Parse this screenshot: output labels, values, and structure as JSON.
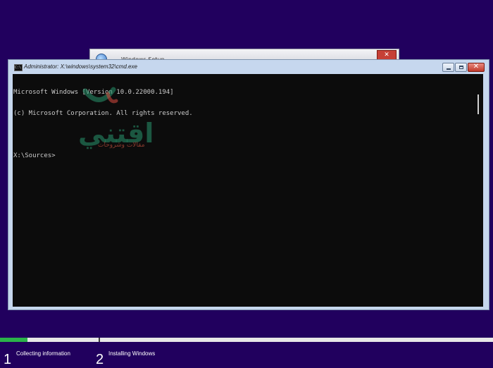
{
  "background_color": "#21005e",
  "setup_window": {
    "title": "Windows Setup",
    "close_label": "✕",
    "icon": "windows-setup-icon"
  },
  "cmd_window": {
    "title": "Administrator: X:\\windows\\system32\\cmd.exe",
    "icon_label": "C:\\",
    "console_lines": [
      "Microsoft Windows [Version 10.0.22000.194]",
      "(c) Microsoft Corporation. All rights reserved.",
      "",
      "X:\\Sources>"
    ],
    "close_label": "✕"
  },
  "watermark": {
    "text": "اقتني",
    "subtext": "مقالات وشروحات"
  },
  "progress": {
    "fraction_complete": 0.055,
    "fill_color": "#2bb24a",
    "steps": [
      {
        "number": "1",
        "label": "Collecting information"
      },
      {
        "number": "2",
        "label": "Installing Windows"
      }
    ]
  }
}
